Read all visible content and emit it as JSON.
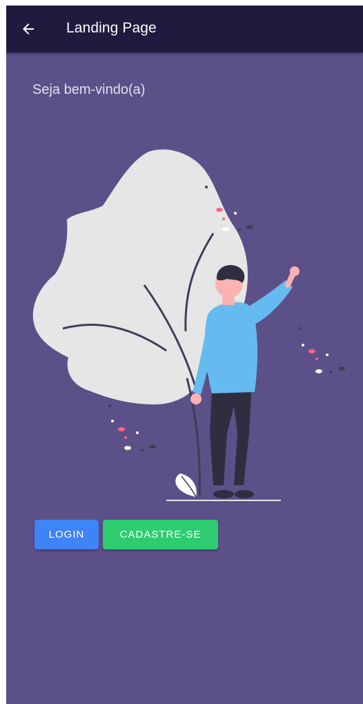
{
  "appbar": {
    "title": "Landing Page",
    "back_icon": "arrow-left-icon"
  },
  "main": {
    "welcome_text": "Seja bem-vindo(a)",
    "illustration": "person-waving-illustration"
  },
  "actions": {
    "login_label": "LOGIN",
    "signup_label": "CADASTRE-SE"
  },
  "colors": {
    "background": "#5c5089",
    "appbar": "#22193f",
    "login_button": "#3e84f7",
    "signup_button": "#2ecc71"
  }
}
